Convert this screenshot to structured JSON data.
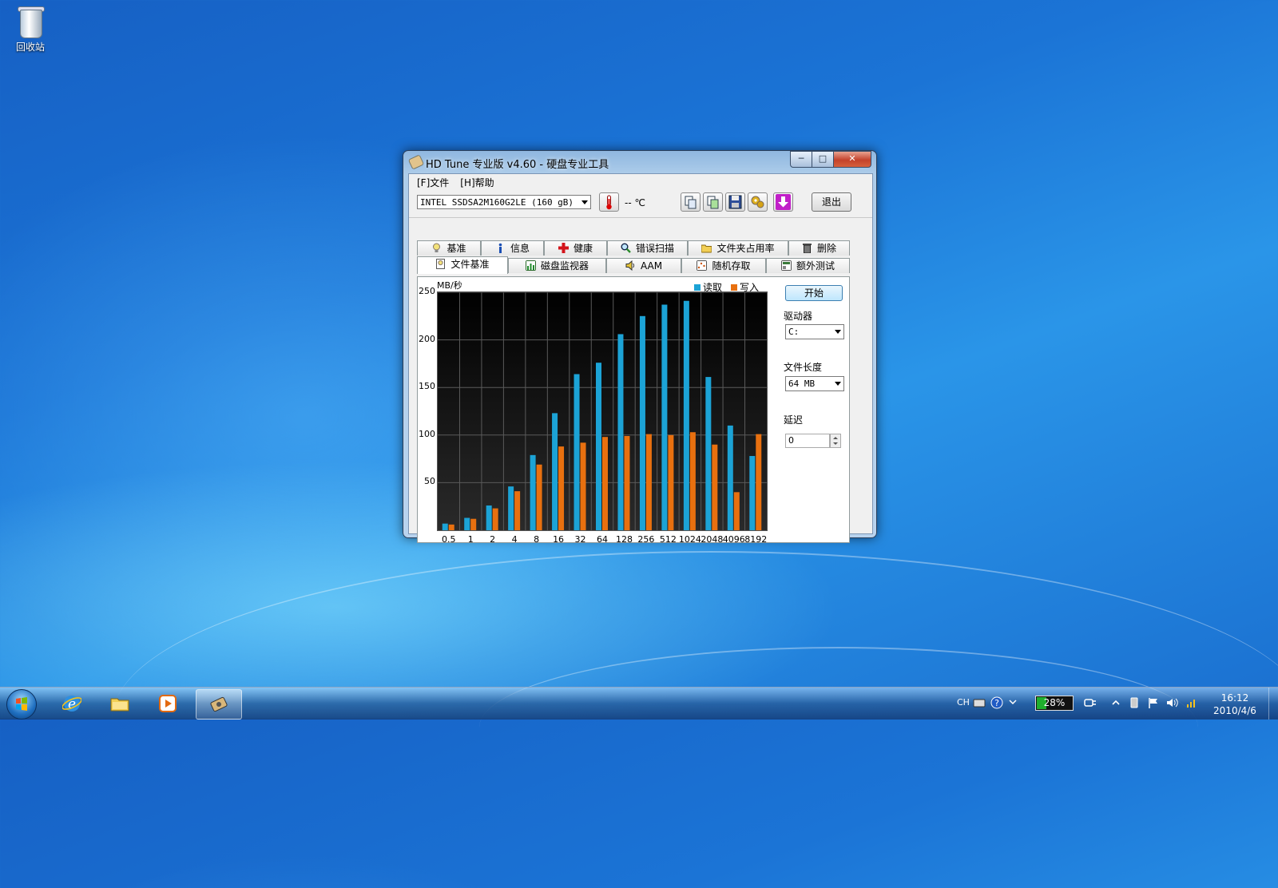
{
  "desktop": {
    "recycle_bin_label": "回收站"
  },
  "window": {
    "title": "HD Tune 专业版 v4.60 - 硬盘专业工具",
    "controls": {
      "minimize": "─",
      "maximize": "□",
      "close": "✕"
    }
  },
  "menu": [
    {
      "label": "[F]文件"
    },
    {
      "label": "[H]帮助"
    }
  ],
  "toolbar": {
    "drive": "INTEL SSDSA2M160G2LE (160 gB)",
    "temperature": "-- ℃",
    "exit_label": "退出"
  },
  "tabs_top": [
    {
      "label": "基准",
      "icon": "bulb-icon"
    },
    {
      "label": "信息",
      "icon": "info-icon"
    },
    {
      "label": "健康",
      "icon": "health-cross-icon"
    },
    {
      "label": "错误扫描",
      "icon": "magnifier-icon"
    },
    {
      "label": "文件夹占用率",
      "icon": "folder-icon"
    },
    {
      "label": "删除",
      "icon": "trash-icon"
    }
  ],
  "tabs_bottom": [
    {
      "label": "文件基准",
      "icon": "file-benchmark-icon",
      "active": true
    },
    {
      "label": "磁盘监视器",
      "icon": "monitor-chart-icon"
    },
    {
      "label": "AAM",
      "icon": "speaker-icon"
    },
    {
      "label": "随机存取",
      "icon": "random-access-icon"
    },
    {
      "label": "额外测试",
      "icon": "extra-tests-icon"
    }
  ],
  "settings": {
    "start_label": "开始",
    "drive_label": "驱动器",
    "drive_value": "C:",
    "file_length_label": "文件长度",
    "file_length_value": "64 MB",
    "delay_label": "延迟",
    "delay_value": "0"
  },
  "chart_data": {
    "type": "bar",
    "ylabel": "MB/秒",
    "ylim": [
      0,
      250
    ],
    "yticks": [
      50,
      100,
      150,
      200,
      250
    ],
    "categories": [
      "0.5",
      "1",
      "2",
      "4",
      "8",
      "16",
      "32",
      "64",
      "128",
      "256",
      "512",
      "1024",
      "2048",
      "4096",
      "8192"
    ],
    "series": [
      {
        "name": "读取",
        "color": "#1ca3d6",
        "values": [
          7,
          13,
          26,
          46,
          79,
          123,
          164,
          176,
          206,
          225,
          237,
          241,
          161,
          110,
          78
        ]
      },
      {
        "name": "写入",
        "color": "#e8700f",
        "values": [
          6,
          12,
          23,
          41,
          69,
          88,
          92,
          98,
          99,
          101,
          100,
          103,
          90,
          40,
          101
        ]
      }
    ],
    "grid": true,
    "legend": "top-right"
  },
  "taskbar": {
    "items": [
      {
        "name": "ie-icon"
      },
      {
        "name": "explorer-folder-icon"
      },
      {
        "name": "media-player-icon"
      },
      {
        "name": "hdtune-icon",
        "active": true
      }
    ],
    "tray": {
      "language": "CH",
      "battery_percent": 28,
      "battery_text": "28%",
      "time": "16:12",
      "date": "2010/4/6"
    }
  }
}
